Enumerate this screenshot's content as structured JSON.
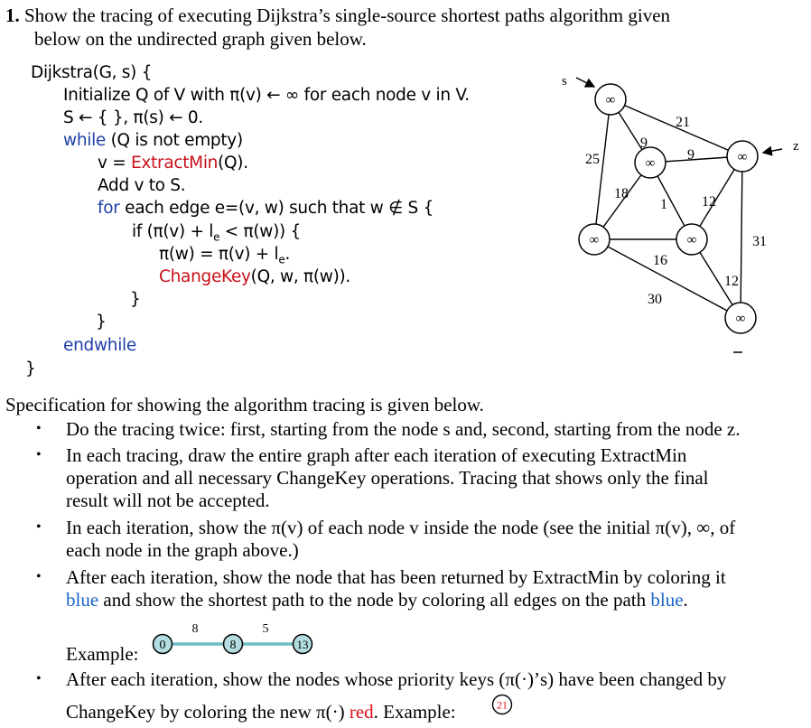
{
  "question": {
    "number": "1.",
    "line1": "Show the tracing of executing Dijkstra’s single-source shortest paths algorithm given",
    "line2": "below on the undirected graph given below."
  },
  "pseudocode": {
    "l1": "Dijkstra(G, s) {",
    "l2": "Initialize Q of V with π(v) ← ∞ for each node v in V.",
    "l3": "S ← { }, π(s) ← 0.",
    "l4_kw": "while",
    "l4": " (Q is not empty)",
    "l5a": "v = ",
    "l5_fn": "ExtractMin",
    "l5b": "(Q).",
    "l6": "Add v to S.",
    "l7_kw": "for",
    "l7": " each edge e=(v, w) such that w ∉ S {",
    "l8a": "if (π(v) + l",
    "l8_sub": "e",
    "l8b": " < π(w)) {",
    "l9a": "π(w) = π(v) + l",
    "l9_sub": "e",
    "l9b": ".",
    "l10_fn": "ChangeKey",
    "l10": "(Q, w, π(w)).",
    "l11": "}",
    "l12": "}",
    "l13_kw": "endwhile",
    "l14": "}"
  },
  "graph": {
    "start_labels": {
      "s": "s",
      "z": "z"
    },
    "nodes": [
      {
        "id": "s",
        "value": "∞"
      },
      {
        "id": "m",
        "value": "∞"
      },
      {
        "id": "z",
        "value": "∞"
      },
      {
        "id": "l",
        "value": "∞"
      },
      {
        "id": "c",
        "value": "∞"
      },
      {
        "id": "b",
        "value": "∞"
      }
    ],
    "edges": [
      {
        "from": "s",
        "to": "z",
        "weight": "21"
      },
      {
        "from": "s",
        "to": "m",
        "weight": "9"
      },
      {
        "from": "s",
        "to": "l",
        "weight": "25"
      },
      {
        "from": "m",
        "to": "z",
        "weight": "9"
      },
      {
        "from": "m",
        "to": "l",
        "weight": "18"
      },
      {
        "from": "m",
        "to": "c",
        "weight": "1"
      },
      {
        "from": "z",
        "to": "c",
        "weight": "12"
      },
      {
        "from": "z",
        "to": "b",
        "weight": "31"
      },
      {
        "from": "l",
        "to": "c",
        "weight": "16"
      },
      {
        "from": "l",
        "to": "b",
        "weight": "30"
      },
      {
        "from": "c",
        "to": "b",
        "weight": "12"
      }
    ]
  },
  "spec": {
    "intro": "Specification for showing the algorithm tracing is given below.",
    "b1": "Do the tracing twice: first, starting from the node s and, second, starting from the node z.",
    "b2_l1": "In each tracing, draw the entire graph after each iteration of executing ExtractMin",
    "b2_l2": "operation and all necessary ChangeKey operations. Tracing that shows only the final",
    "b2_l3": "result will not be accepted.",
    "b3_l1": "In each iteration, show the π(v) of each node v inside the node (see the initial π(v), ∞, of",
    "b3_l2": "each node in the graph above.)",
    "b4_l1": "After each iteration, show the node that has been returned by ExtractMin by coloring it",
    "b4_l2_blue1": "blue",
    "b4_l2_mid": " and show the shortest path to the node by coloring all edges on the path ",
    "b4_l2_blue2": "blue",
    "b4_l2_end": ".",
    "example1_label": "Example:",
    "example1": {
      "nodes": [
        "0",
        "8",
        "13"
      ],
      "weights": [
        "8",
        "5"
      ],
      "color": "#b3dde0"
    },
    "b5_l1": "After each iteration, show the nodes whose priority keys (π(·)’s) have been changed by",
    "b5_l2a": "ChangeKey by coloring the new π(·) ",
    "b5_l2_red": "red",
    "b5_l2b": ". Example:",
    "example2_value": "21",
    "bullet_char": "•"
  },
  "colors": {
    "keyword": "#1f3fa8",
    "function": "#c8101a",
    "blue": "#1a64c8",
    "red": "#e0101a"
  }
}
